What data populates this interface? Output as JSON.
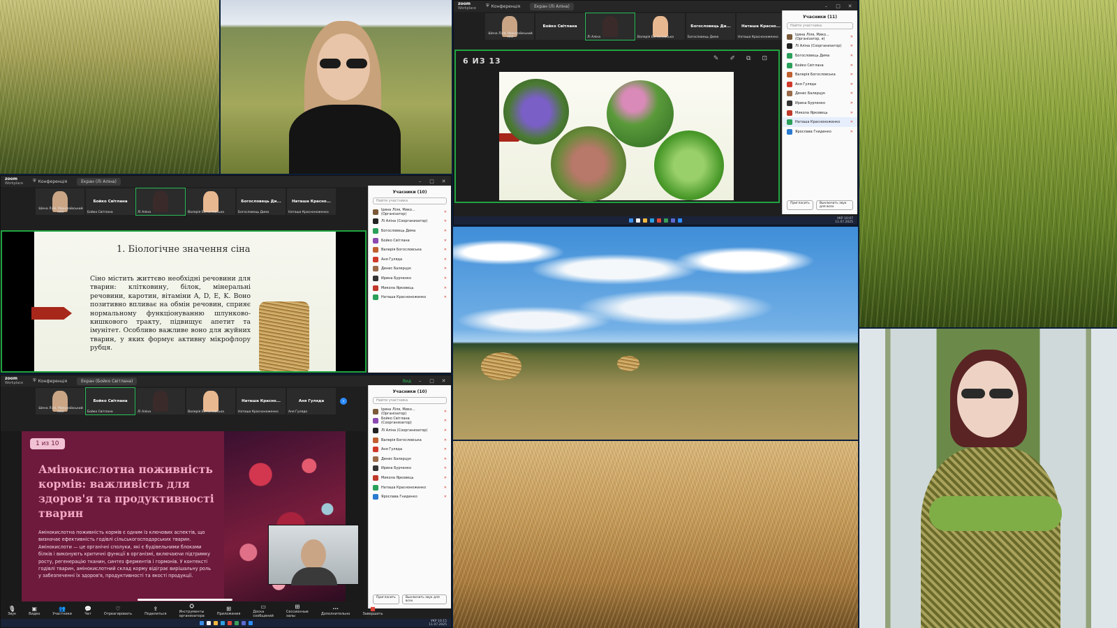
{
  "zoom_a": {
    "brand": "zoom",
    "brand_sub": "Workplace",
    "tab_conference": "Конференція",
    "tab_screen": "Екран (Лі Аліна)",
    "participants_title": "Учасники (11)",
    "search_placeholder": "Найти участника",
    "invite": "Пригласить",
    "mute_all": "Выключить звук для всех",
    "page_counter": "6 ИЗ 13",
    "thumbs": [
      {
        "label": "",
        "name": "Шена Ліля, Миколаївський НАУ"
      },
      {
        "label": "Бойко Світлана",
        "name": ""
      },
      {
        "label": "",
        "name": "Лі Аліна"
      },
      {
        "label": "",
        "name": "Валерія Богословська"
      },
      {
        "label": "Богословець Ди...",
        "name": "Богословець Дима"
      },
      {
        "label": "Наташа Красно...",
        "name": "Наташа Красноноженко"
      }
    ],
    "participants": [
      {
        "name": "Ірина Ліля, Мико... (Організатор, я)",
        "color": "#7a5a3a"
      },
      {
        "name": "Лі Аліна (Соорганизатор)",
        "color": "#222222"
      },
      {
        "name": "Богословець Дима",
        "color": "#2aa05a"
      },
      {
        "name": "Бойко Світлана",
        "color": "#2aa05a"
      },
      {
        "name": "Валерія Богословська",
        "color": "#c06030"
      },
      {
        "name": "Аня Гуляда",
        "color": "#d03a2a"
      },
      {
        "name": "Денис Балерцук",
        "color": "#9a6a4a"
      },
      {
        "name": "Ирина Бурченко",
        "color": "#333333"
      },
      {
        "name": "Микола Ярковець",
        "color": "#c0392b"
      },
      {
        "name": "Наташа Красноноженко",
        "color": "#2aa05a"
      },
      {
        "name": "Ярослава Гниденко",
        "color": "#2a7ad0"
      }
    ],
    "tray_lang": "УКР",
    "tray_time": "10:07",
    "tray_date": "11.07.2025"
  },
  "zoom_b": {
    "brand": "zoom",
    "brand_sub": "Workplace",
    "tab_conference": "Конференція",
    "tab_screen": "Екран (Лі Аліна)",
    "participants_title": "Учасники (10)",
    "search_placeholder": "Найти участника",
    "thumbs": [
      {
        "label": "",
        "name": "Шена Ліля, Миколаївський НАУ"
      },
      {
        "label": "Бойко Світлана",
        "name": "Бойко Світлана"
      },
      {
        "label": "",
        "name": "Лі Аліна"
      },
      {
        "label": "",
        "name": "Валерія Богословська"
      },
      {
        "label": "Богословець Ди...",
        "name": "Богословець Дима"
      },
      {
        "label": "Наташа Красно...",
        "name": "Наташа Красноноженко"
      }
    ],
    "participants": [
      {
        "name": "Ірина Ліля, Мико... (Організатор)",
        "color": "#7a5a3a"
      },
      {
        "name": "Лі Аліна (Соорганизатор)",
        "color": "#222222"
      },
      {
        "name": "Богословець Дима",
        "color": "#2aa05a"
      },
      {
        "name": "Бойко Світлана",
        "color": "#8a4ab0"
      },
      {
        "name": "Валерія Богословська",
        "color": "#c06030"
      },
      {
        "name": "Аня Гуляда",
        "color": "#d03a2a"
      },
      {
        "name": "Денис Балерцук",
        "color": "#9a6a4a"
      },
      {
        "name": "Ирина Бурченко",
        "color": "#333333"
      },
      {
        "name": "Микола Ярковець",
        "color": "#c0392b"
      },
      {
        "name": "Наташа Красноноженко",
        "color": "#2aa05a"
      }
    ],
    "slide_title": "1. Біологічне значення сіна",
    "slide_text": "Сіно містить життєво необхідні речовини для тварин: клітковину, білок, мінеральні речовини, каротин, вітаміни A, D, E, K. Воно позитивно впливає на обмін речовин, сприяє нормальному функціонуванню шлунково-кишкового тракту, підвищує апетит та імунітет. Особливо важливе воно для жуйних тварин, у яких формує активну мікрофлору рубця."
  },
  "zoom_c": {
    "brand": "zoom",
    "brand_sub": "Workplace",
    "tab_conference": "Конференція",
    "tab_screen": "Екран (Бойко Світлана)",
    "participants_title": "Учасники (10)",
    "search_placeholder": "Найти участника",
    "invite": "Пригласить",
    "mute_all": "Выключить звук для всех",
    "thumbs": [
      {
        "label": "",
        "name": "Шена Ліля, Миколаївський НАУ"
      },
      {
        "label": "Бойко Світлана",
        "name": "Бойко Світлана"
      },
      {
        "label": "",
        "name": "Лі Аліна"
      },
      {
        "label": "",
        "name": "Валерія Богословська"
      },
      {
        "label": "Наташа Красно...",
        "name": "Наташа Красноноженко"
      },
      {
        "label": "Аня Гуляда",
        "name": "Аня Гуляда"
      }
    ],
    "participants": [
      {
        "name": "Ірина Ліля, Мико... (Організатор)",
        "color": "#7a5a3a"
      },
      {
        "name": "Бойко Світлана (Соорганизатор)",
        "color": "#8a4ab0"
      },
      {
        "name": "Лі Аліна (Соорганизатор)",
        "color": "#222222"
      },
      {
        "name": "Валерія Богословська",
        "color": "#c06030"
      },
      {
        "name": "Аня Гуляда",
        "color": "#d03a2a"
      },
      {
        "name": "Денис Балерцук",
        "color": "#9a6a4a"
      },
      {
        "name": "Ирина Бурченко",
        "color": "#333333"
      },
      {
        "name": "Микола Ярковець",
        "color": "#c0392b"
      },
      {
        "name": "Наташа Красноноженко",
        "color": "#2aa05a"
      },
      {
        "name": "Ярослава Гниденко",
        "color": "#2a7ad0"
      }
    ],
    "page_pill": "1 из 10",
    "slide_title": "Амінокислотна поживність кормів: важливість для здоров'я та продуктивності тварин",
    "slide_text": "Амінокислотна поживність кормів є одним із ключових аспектів, що визначає ефективність годівлі сільськогосподарських тварин. Амінокислоти — це органічні сполуки, які є будівельними блоками білків і виконують критичні функції в організмі, включаючи підтримку росту, регенерацію тканин, синтез ферментів і гормонів. У контексті годівлі тварин, амінокислотний склад корму відіграє вирішальну роль у забезпеченні їх здоров'я, продуктивності та якості продукції.",
    "toolbar": [
      "Звук",
      "Видео",
      "Участники",
      "Чат",
      "Отреагировать",
      "Поделиться",
      "Инструменты организатора",
      "Приложения",
      "Доска сообщений",
      "Сессионные залы",
      "Дополнительно",
      "Завершить"
    ],
    "tray_lang": "УКР",
    "tray_time": "10:15",
    "tray_date": "11.07.2025",
    "status": "Вид"
  }
}
